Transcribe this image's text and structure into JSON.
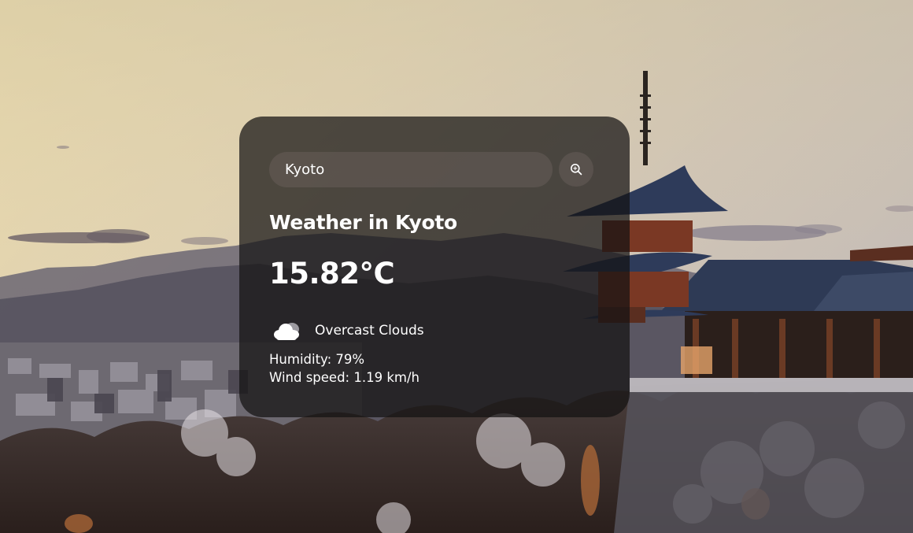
{
  "search": {
    "value": "Kyoto",
    "button_icon": "search-icon"
  },
  "weather": {
    "title": "Weather in Kyoto",
    "temperature": "15.82°C",
    "condition_icon": "overcast-clouds-icon",
    "description": "Overcast Clouds",
    "humidity": "Humidity: 79%",
    "wind": "Wind speed: 1.19 km/h"
  },
  "colors": {
    "card_background": "#141212",
    "text": "#ffffff",
    "input_background": "#7e706e"
  }
}
